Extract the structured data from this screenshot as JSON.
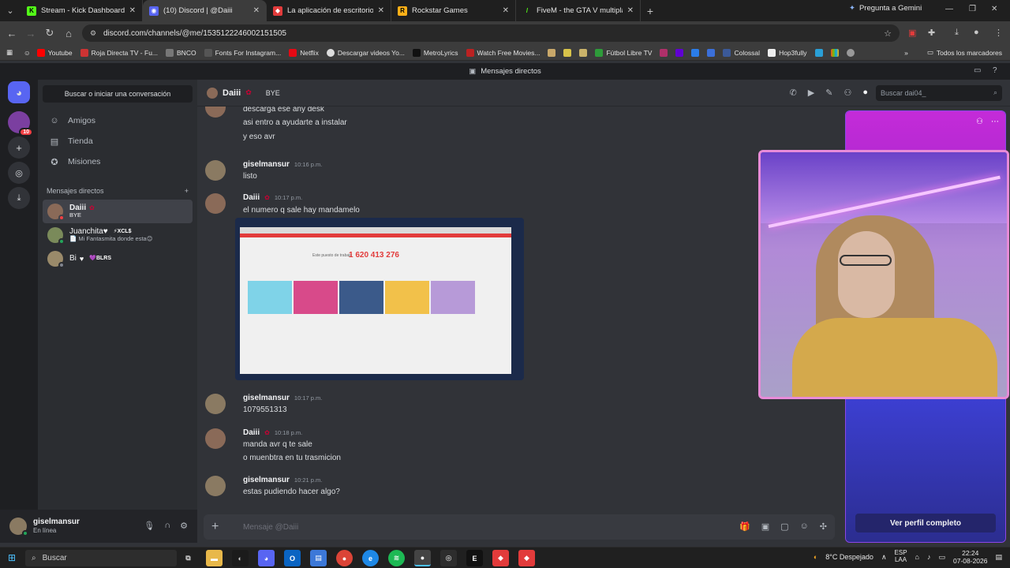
{
  "browser": {
    "tabs": [
      {
        "title": "Stream - Kick Dashboard",
        "fav": "K",
        "color": "#53fc18",
        "active": false
      },
      {
        "title": "(10) Discord | @Daiii",
        "fav": "10",
        "color": "#5865f2",
        "active": true
      },
      {
        "title": "La aplicación de escritorio remo",
        "fav": "A",
        "color": "#e23b3b",
        "active": false
      },
      {
        "title": "Rockstar Games",
        "fav": "R",
        "color": "#fcaf17",
        "active": false
      },
      {
        "title": "FiveM - the GTA V multiplayer m",
        "fav": "F",
        "color": "#f40552",
        "active": false
      }
    ],
    "gemini_label": "Pregunta a Gemini",
    "url": "discord.com/channels/@me/1535122246002151505",
    "bookmarks": [
      "Youtube",
      "Roja Directa TV - Fu...",
      "BNCO",
      "Fonts For Instagram...",
      "Netflix",
      "Descargar videos Yo...",
      "MetroLyrics",
      "Watch Free Movies...",
      "Fútbol Libre TV",
      "Colossal",
      "Hop3fully"
    ],
    "bookmarks_all": "Todos los marcadores"
  },
  "discord": {
    "window_title": "Mensajes directos",
    "rail_badge": "10",
    "sidebar": {
      "search": "Buscar o iniciar una conversación",
      "nav": [
        {
          "label": "Amigos",
          "icon": "friends-icon"
        },
        {
          "label": "Tienda",
          "icon": "shop-icon"
        },
        {
          "label": "Misiones",
          "icon": "quests-icon"
        }
      ],
      "dm_header": "Mensajes directos",
      "dms": [
        {
          "name": "Daiii",
          "sub": "BYE",
          "tag": "",
          "color": "#8a6a58",
          "selected": true
        },
        {
          "name": "Juanchita♥",
          "sub": "📄 Mi Fantasmita donde esta😊",
          "tag": "⚡XCL$",
          "color": "#7a8a5a",
          "selected": false
        },
        {
          "name": "Bi",
          "sub": "",
          "tag": "💜BLRS",
          "color": "#9a8a6a",
          "selected": false
        }
      ]
    },
    "user": {
      "name": "giselmansur",
      "status": "En línea"
    },
    "chat": {
      "name": "Daiii",
      "status": "BYE",
      "search_placeholder": "Buscar dai04_",
      "composer_placeholder": "Mensaje @Daiii",
      "messages": [
        {
          "lines": [
            "descarga ese any desk",
            "asi entro a ayudarte a instalar",
            "y eso avr"
          ]
        },
        {
          "author": "giselmansur",
          "time": "10:16 p.m.",
          "lines": [
            "listo"
          ]
        },
        {
          "author": "Daiii",
          "time": "10:17 p.m.",
          "lines": [
            "el numero q sale hay mandamelo"
          ]
        },
        {
          "author": "giselmansur",
          "time": "10:17 p.m.",
          "lines": [
            "1079551313"
          ]
        },
        {
          "author": "Daiii",
          "time": "10:18 p.m.",
          "lines": [
            "manda avr q te sale",
            "o muenbtra en tu trasmicion"
          ]
        },
        {
          "author": "giselmansur",
          "time": "10:21 p.m.",
          "lines": [
            "estas pudiendo hacer algo?"
          ]
        }
      ],
      "attachment": {
        "label": "Este puesto de trabajo",
        "number": "1 620 413 276"
      }
    },
    "profile": {
      "button": "Ver perfil completo"
    }
  },
  "taskbar": {
    "search": "Buscar",
    "weather": "8°C  Despejado",
    "lang": "ESP",
    "lang2": "LAA",
    "time": "22:24",
    "date": "07-08-2026"
  }
}
